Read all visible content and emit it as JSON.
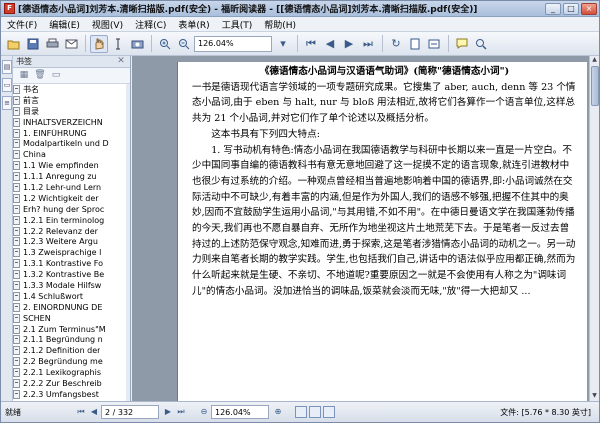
{
  "window": {
    "title": "[德语情态小品词]刘芳本.清晰扫描版.pdf(安全) - 福昕阅读器 - [[德语情态小品词]刘芳本.清晰扫描版.pdf(安全)]",
    "app_icon_text": "F",
    "controls": [
      "_",
      "□",
      "×"
    ]
  },
  "menu": [
    "文件(F)",
    "编辑(E)",
    "视图(V)",
    "注释(C)",
    "表单(R)",
    "工具(T)",
    "帮助(H)"
  ],
  "toolbar": {
    "icons": [
      "open-icon",
      "save-icon",
      "print-icon",
      "email-icon",
      "hand-icon",
      "select-text-icon",
      "snapshot-icon",
      "zoom-in-icon",
      "zoom-out-icon",
      "first-page-icon",
      "prev-page-icon",
      "next-page-icon",
      "last-page-icon",
      "rotate-icon",
      "fit-page-icon",
      "fit-width-icon",
      "comment-icon",
      "search-icon"
    ],
    "zoom_value": "126.04%"
  },
  "sidebar": {
    "header": "书签",
    "items": [
      {
        "label": "书名"
      },
      {
        "label": "前言"
      },
      {
        "label": "目录"
      },
      {
        "label": "INHALTSVERZEICHN"
      },
      {
        "label": "1. EINFÜHRUNG"
      },
      {
        "label": "Modalpartikeln und D"
      },
      {
        "label": "China"
      },
      {
        "label": "1.1  Wie empfinden"
      },
      {
        "label": "1.1.1  Anregung zu"
      },
      {
        "label": "1.1.2  Lehr-und Lern"
      },
      {
        "label": "1.2  Wichtigkeit der"
      },
      {
        "label": "Erh? hung der Sproc"
      },
      {
        "label": "1.2.1  Ein terminolog"
      },
      {
        "label": "1.2.2  Relevanz der"
      },
      {
        "label": "1.2.3  Weitere Argu"
      },
      {
        "label": "1.3  Zweisprachige l"
      },
      {
        "label": "1.3.1  Kontrastive Fo"
      },
      {
        "label": "1.3.2  Kontrastive Be"
      },
      {
        "label": "1.3.3  Modale Hilfsw"
      },
      {
        "label": "1.4  Schlußwort"
      },
      {
        "label": "2.  EINORDNUNG DE"
      },
      {
        "label": "SCHEN"
      },
      {
        "label": "2.1  Zum Terminus\"M"
      },
      {
        "label": "2.1.1  Begründung n"
      },
      {
        "label": "2.1.2  Definition der"
      },
      {
        "label": "2.2  Begründung me"
      },
      {
        "label": "2.2.1  Lexikographis"
      },
      {
        "label": "2.2.2  Zur Beschreib"
      },
      {
        "label": "2.2.3  Umfangsbest"
      }
    ]
  },
  "document": {
    "paragraphs": [
      {
        "style": "c",
        "text": "《德语情态小品词与汉语语气助词》(简称\"德语情态小词\")"
      },
      {
        "style": "",
        "text": "一书是德语现代语言学领域的一项专题研究成果。它搜集了 aber, auch, denn 等 23 个情态小品词,由于 eben 与 halt, nur 与 bloß 用法相近,故将它们各算作一个语言单位,这样总共为 21 个小品词,并对它们作了单个论述以及概括分析。"
      },
      {
        "style": "ind",
        "text": "这本书具有下列四大特点:"
      },
      {
        "style": "ind",
        "text": "1. 写书动机有特色:情态小品词在我国德语教学与科研中长期以来一直是一片空白。不少中国同事自编的德语教科书有意无意地回避了这一捉摸不定的语言现象,就连引进教材中也很少有过系统的介绍。一种观点曾经相当普遍地影响着中国的德语界,即:小品词诚然在交际活动中不可缺少,有着丰富的内涵,但是作为外国人,我们的语感不够强,把握不住其中的奥妙,因而不宜鼓励学生运用小品词,\"与其用错,不如不用\"。在中德日曼语文学在我国蓬勃传播的今天,我们再也不愿自暴自弃、无所作为地坐视这片土地荒芜下去。于是笔者一反过去曾持过的上述防范保守观念,知难而进,勇于探索,这是笔者涉猎情态小品词的动机之一。另一动力则来自笔者长期的教学实践。学生,也包括我们自己,讲话中的语法似乎应用都正确,然而为什么听起来就是生硬、不亲切、不地道呢?重要原因之一就是不会使用有人称之为\"调味词儿\"的情态小品词。没加进恰当的调味品,饭菜就会淡而无味,\"放\"得一大把却又 ..."
      }
    ]
  },
  "status": {
    "ready": "就绪",
    "page_current": "2",
    "page_total": "332",
    "page_display": "2 / 332",
    "zoom": "126.04%",
    "doc_size": "文件: [5.76 * 8.30 英寸]"
  }
}
